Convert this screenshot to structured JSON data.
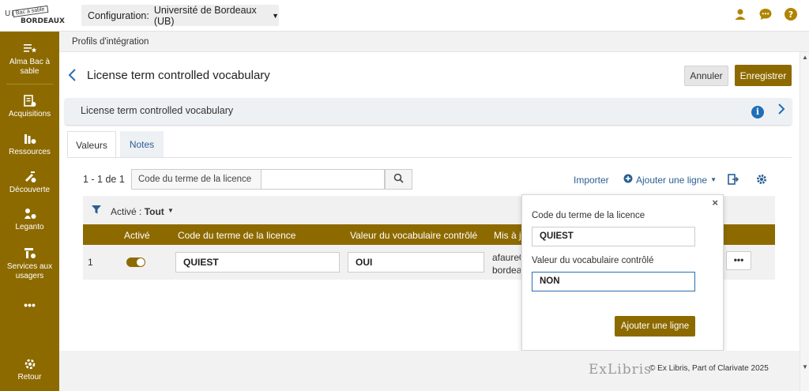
{
  "header": {
    "logo_text_top": "UNIV",
    "logo_text_bottom": "BORDEAUX",
    "logo_stamp": "Bac à sable",
    "config_label": "Configuration:",
    "config_value": "Université de Bordeaux (UB)",
    "icons": [
      "user-icon",
      "chat-icon",
      "help-icon"
    ]
  },
  "sidebar": {
    "items": [
      {
        "label": "Alma Bac à sable",
        "icon": "menu-star-icon"
      },
      {
        "label": "Acquisitions",
        "icon": "acquisitions-icon"
      },
      {
        "label": "Ressources",
        "icon": "resources-icon"
      },
      {
        "label": "Découverte",
        "icon": "discovery-icon"
      },
      {
        "label": "Leganto",
        "icon": "leganto-icon"
      },
      {
        "label": "Services aux usagers",
        "icon": "user-services-icon"
      },
      {
        "label": "•••",
        "icon": "more-icon"
      },
      {
        "label": "Retour",
        "icon": "return-icon"
      }
    ]
  },
  "breadcrumb": "Profils d'intégration",
  "page": {
    "title": "License term controlled vocabulary",
    "cancel_label": "Annuler",
    "save_label": "Enregistrer",
    "section_title": "License term controlled vocabulary"
  },
  "tabs": [
    {
      "label": "Valeurs",
      "active": true
    },
    {
      "label": "Notes",
      "active": false
    }
  ],
  "toolbar": {
    "count": "1 - 1 de 1",
    "search_field": "Code du terme de la licence",
    "search_value": "",
    "import_label": "Importer",
    "add_row_label": "Ajouter une ligne"
  },
  "filter": {
    "label": "Activé :",
    "value": "Tout"
  },
  "table": {
    "columns": [
      "Activé",
      "Code du terme de la licence",
      "Valeur du vocabulaire contrôlé",
      "Mis à jo"
    ],
    "rows": [
      {
        "num": "1",
        "active": true,
        "code": "QUIEST",
        "value": "OUI",
        "updated_line1": "afaure0",
        "updated_line2": "bordeau",
        "more": "•••"
      }
    ]
  },
  "popup": {
    "close": "×",
    "field1_label": "Code du terme de la licence",
    "field1_value": "QUIEST",
    "field2_label": "Valeur du vocabulaire contrôlé",
    "field2_value": "NON",
    "add_label": "Ajouter une ligne"
  },
  "footer": {
    "brand": "ExLibris",
    "copyright": "© Ex Libris, Part of Clarivate  2025"
  },
  "colors": {
    "accent": "#8d6a00",
    "link": "#2a5f92",
    "info": "#1f6fb8"
  }
}
